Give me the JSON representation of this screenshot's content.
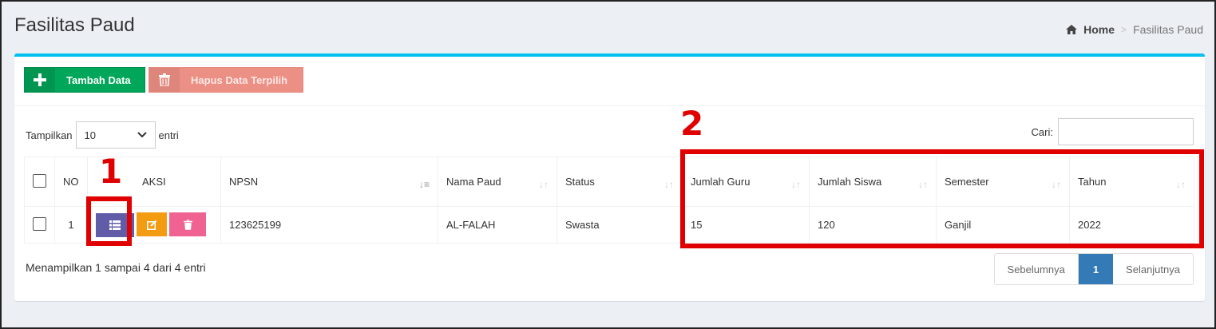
{
  "page": {
    "title": "Fasilitas Paud"
  },
  "breadcrumb": {
    "home": "Home",
    "current": "Fasilitas Paud"
  },
  "toolbar": {
    "add_label": "Tambah Data",
    "delete_label": "Hapus Data Terpilih"
  },
  "controls": {
    "show_prefix": "Tampilkan",
    "show_value": "10",
    "show_suffix": "entri",
    "search_label": "Cari:",
    "search_value": ""
  },
  "table": {
    "headers": [
      "NO",
      "AKSI",
      "NPSN",
      "Nama Paud",
      "Status",
      "Jumlah Guru",
      "Jumlah Siswa",
      "Semester",
      "Tahun"
    ],
    "rows": [
      {
        "no": "1",
        "npsn": "123625199",
        "nama": "AL-FALAH",
        "status": "Swasta",
        "guru": "15",
        "siswa": "120",
        "semester": "Ganjil",
        "tahun": "2022"
      }
    ]
  },
  "footer": {
    "info": "Menampilkan 1 sampai 4 dari 4 entri",
    "prev": "Sebelumnya",
    "page": "1",
    "next": "Selanjutnya"
  },
  "annotations": {
    "one": "1",
    "two": "2"
  },
  "colors": {
    "accent": "#00c0ef",
    "add": "#00a65a",
    "delete": "#ec8f84",
    "highlight": "#e00000",
    "page_active": "#337ab7"
  }
}
